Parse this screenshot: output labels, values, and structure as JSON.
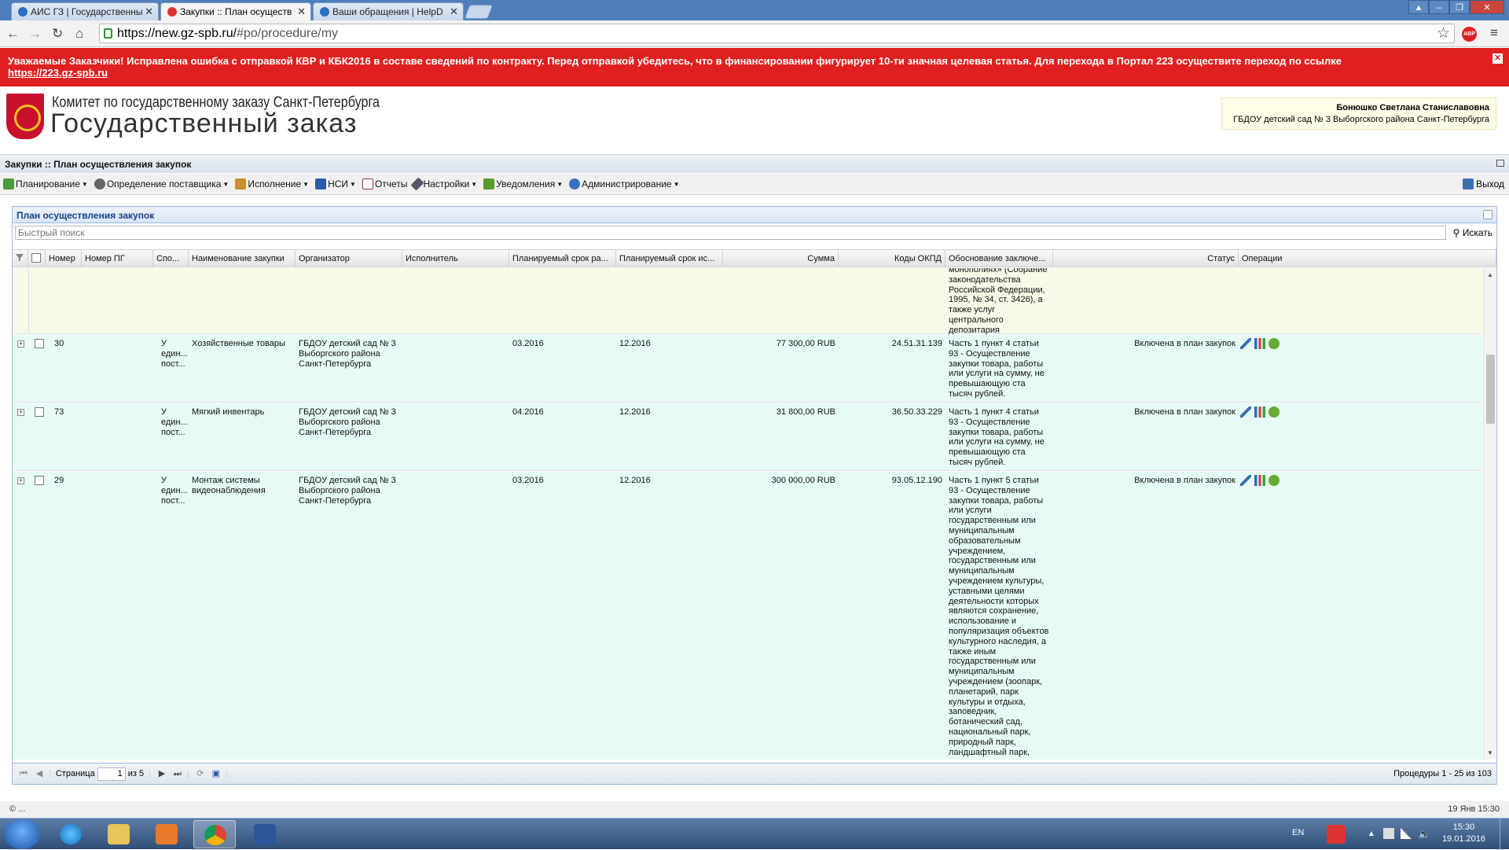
{
  "browser": {
    "tabs": [
      {
        "title": "АИС ГЗ | Государственны",
        "active": false
      },
      {
        "title": "Закупки :: План осуществ",
        "active": true
      },
      {
        "title": "Ваши обращения | HelpD",
        "active": false
      }
    ],
    "url_host": "https://new.gz-spb.ru/",
    "url_path": "#po/procedure/my",
    "abp": "ABP"
  },
  "banner": {
    "text": "Уважаемые Заказчики! Исправлена ошибка с отправкой КВР и КБК2016 в составе сведений по контракту. Перед отправкой убедитесь, что в финансировании фигурирует 10-ти значная целевая статья. Для перехода в Портал 223 осуществите переход по ссылке",
    "link": "https://223.gz-spb.ru",
    "close": "✕"
  },
  "header": {
    "org": "Комитет по государственному заказу Санкт-Петербурга",
    "title": "Государственный заказ",
    "user_name": "Бонюшко Светлана Станиславовна",
    "user_org": "ГБДОУ детский сад № 3 Выборгского района Санкт-Петербурга"
  },
  "panel_title": "Закупки :: План осуществления закупок",
  "menu": [
    {
      "label": "Планирование",
      "color": "#4a9a3a",
      "dd": true
    },
    {
      "label": "Определение поставщика",
      "color": "#666",
      "dd": true
    },
    {
      "label": "Исполнение",
      "color": "#c9902a",
      "dd": true
    },
    {
      "label": "НСИ",
      "color": "#2a5aa8",
      "dd": true
    },
    {
      "label": "Отчеты",
      "color": "#b03030",
      "dd": false
    },
    {
      "label": "Настройки",
      "color": "#556",
      "dd": true
    },
    {
      "label": "Уведомления",
      "color": "#5a9a2a",
      "dd": true
    },
    {
      "label": "Администрирование",
      "color": "#3a70c0",
      "dd": true
    }
  ],
  "exit_label": "Выход",
  "grid": {
    "title": "План осуществления закупок",
    "search_placeholder": "Быстрый поиск",
    "search_button": "Искать",
    "columns": [
      "",
      "",
      "Номер",
      "Номер ПГ",
      "Спо...",
      "Наименование закупки",
      "Организатор",
      "Исполнитель",
      "Планируемый срок ра...",
      "Планируемый срок ис...",
      "Сумма",
      "Коды ОКПД",
      "Обоснование заключе...",
      "Статус",
      "Операции"
    ],
    "partial_row": {
      "basis": "монополиях» (Собрание законодательства Российской Федерации, 1995, № 34, ст. 3426), а также услуг центрального депозитария"
    },
    "rows": [
      {
        "num": "30",
        "pg": "",
        "method": "У един... пост...",
        "name": "Хозяйственные товары",
        "org": "ГБДОУ детский сад № 3 Выборгского района Санкт-Петербурга",
        "exec": "",
        "start": "03.2016",
        "end": "12.2016",
        "sum": "77 300,00 RUB",
        "okpd": "24.51.31.139",
        "basis": "Часть 1 пункт 4 статьи 93 - Осуществление закупки товара, работы или услуги на сумму, не превышающую ста тысяч рублей.",
        "status": "Включена в план закупок"
      },
      {
        "num": "73",
        "pg": "",
        "method": "У един... пост...",
        "name": "Мягкий инвентарь",
        "org": "ГБДОУ детский сад № 3 Выборгского района Санкт-Петербурга",
        "exec": "",
        "start": "04.2016",
        "end": "12.2016",
        "sum": "31 800,00 RUB",
        "okpd": "36.50.33.229",
        "basis": "Часть 1 пункт 4 статьи 93 - Осуществление закупки товара, работы или услуги на сумму, не превышающую ста тысяч рублей.",
        "status": "Включена в план закупок"
      },
      {
        "num": "29",
        "pg": "",
        "method": "У един... пост...",
        "name": "Монтаж системы видеонаблюдения",
        "org": "ГБДОУ детский сад № 3 Выборгского района Санкт-Петербурга",
        "exec": "",
        "start": "03.2016",
        "end": "12.2016",
        "sum": "300 000,00 RUB",
        "okpd": "93.05.12.190",
        "basis": "Часть 1 пункт 5 статьи 93 - Осуществление закупки товара, работы или услуги государственным или муниципальным образовательным учреждением, государственным или муниципальным учреждением культуры, уставными целями деятельности которых являются сохранение, использование и популяризация объектов культурного наследия, а также иным государственным или муниципальным учреждением (зоопарк, планетарий, парк культуры и отдыха, заповедник, ботанический сад, национальный парк, природный парк, ландшафтный парк,",
        "status": "Включена в план закупок"
      }
    ]
  },
  "pager": {
    "page_label": "Страница",
    "page": "1",
    "of": "из 5",
    "info": "Процедуры 1 - 25 из 103"
  },
  "status": {
    "left": "© ...",
    "right": "19 Янв 15:30"
  },
  "taskbar": {
    "lang": "EN",
    "time": "15:30",
    "date": "19.01.2016"
  }
}
